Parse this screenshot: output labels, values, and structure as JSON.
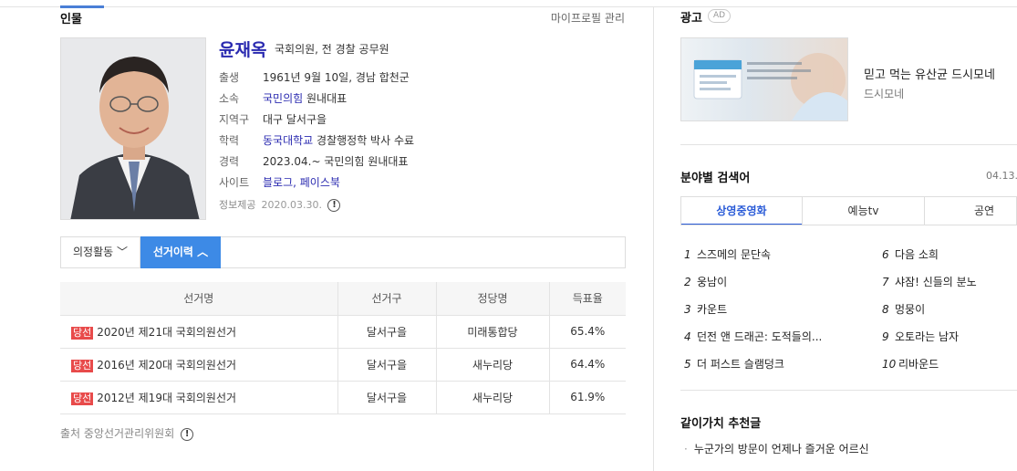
{
  "person": {
    "section_title": "인물",
    "profile_manage": "마이프로필 관리",
    "name": "윤재옥",
    "subtitle": "국회의원, 전 경찰 공무원",
    "info": [
      {
        "label": "출생",
        "value": "1961년 9월 10일, 경남 합천군"
      },
      {
        "label": "소속",
        "link": "국민의힘",
        "value": "원내대표"
      },
      {
        "label": "지역구",
        "value": "대구 달서구을"
      },
      {
        "label": "학력",
        "link": "동국대학교",
        "value": "경찰행정학 박사 수료"
      },
      {
        "label": "경력",
        "value": "2023.04.~ 국민의힘 원내대표"
      },
      {
        "label": "사이트",
        "link": "블로그",
        "link2": "페이스북"
      }
    ],
    "source_label": "정보제공",
    "source_date": "2020.03.30."
  },
  "tabs": {
    "activity": "의정활동",
    "history": "선거이력"
  },
  "election_table": {
    "headers": [
      "선거명",
      "선거구",
      "정당명",
      "득표율"
    ],
    "badge": "당선",
    "rows": [
      {
        "name": "2020년 제21대 국회의원선거",
        "district": "달서구을",
        "party": "미래통합당",
        "rate": "65.4%"
      },
      {
        "name": "2016년 제20대 국회의원선거",
        "district": "달서구을",
        "party": "새누리당",
        "rate": "64.4%"
      },
      {
        "name": "2012년 제19대 국회의원선거",
        "district": "달서구을",
        "party": "새누리당",
        "rate": "61.9%"
      }
    ],
    "source": "출처 중앙선거관리위원회"
  },
  "ad": {
    "title": "광고",
    "badge": "AD",
    "product": "믿고 먹는 유산균 드시모네",
    "brand": "드시모네"
  },
  "keywords": {
    "title": "분야별 검색어",
    "date": "04.13.",
    "tabs": [
      "상영중영화",
      "예능tv",
      "공연"
    ],
    "items": [
      {
        "num": "1",
        "text": "스즈메의 문단속"
      },
      {
        "num": "2",
        "text": "웅남이"
      },
      {
        "num": "3",
        "text": "카운트"
      },
      {
        "num": "4",
        "text": "던전 앤 드래곤: 도적들의..."
      },
      {
        "num": "5",
        "text": "더 퍼스트 슬램덩크"
      },
      {
        "num": "6",
        "text": "다음 소희"
      },
      {
        "num": "7",
        "text": "샤잠! 신들의 분노"
      },
      {
        "num": "8",
        "text": "멍뭉이"
      },
      {
        "num": "9",
        "text": "오토라는 남자"
      },
      {
        "num": "10",
        "text": "리바운드"
      }
    ]
  },
  "recommend": {
    "title": "같이가치 추천글",
    "items": [
      "누군가의 방문이 언제나 즐거운 어르신"
    ]
  },
  "colors": {
    "accent": "#3d8ae6",
    "link": "#2a2ab0",
    "win_badge": "#e84a4a"
  }
}
